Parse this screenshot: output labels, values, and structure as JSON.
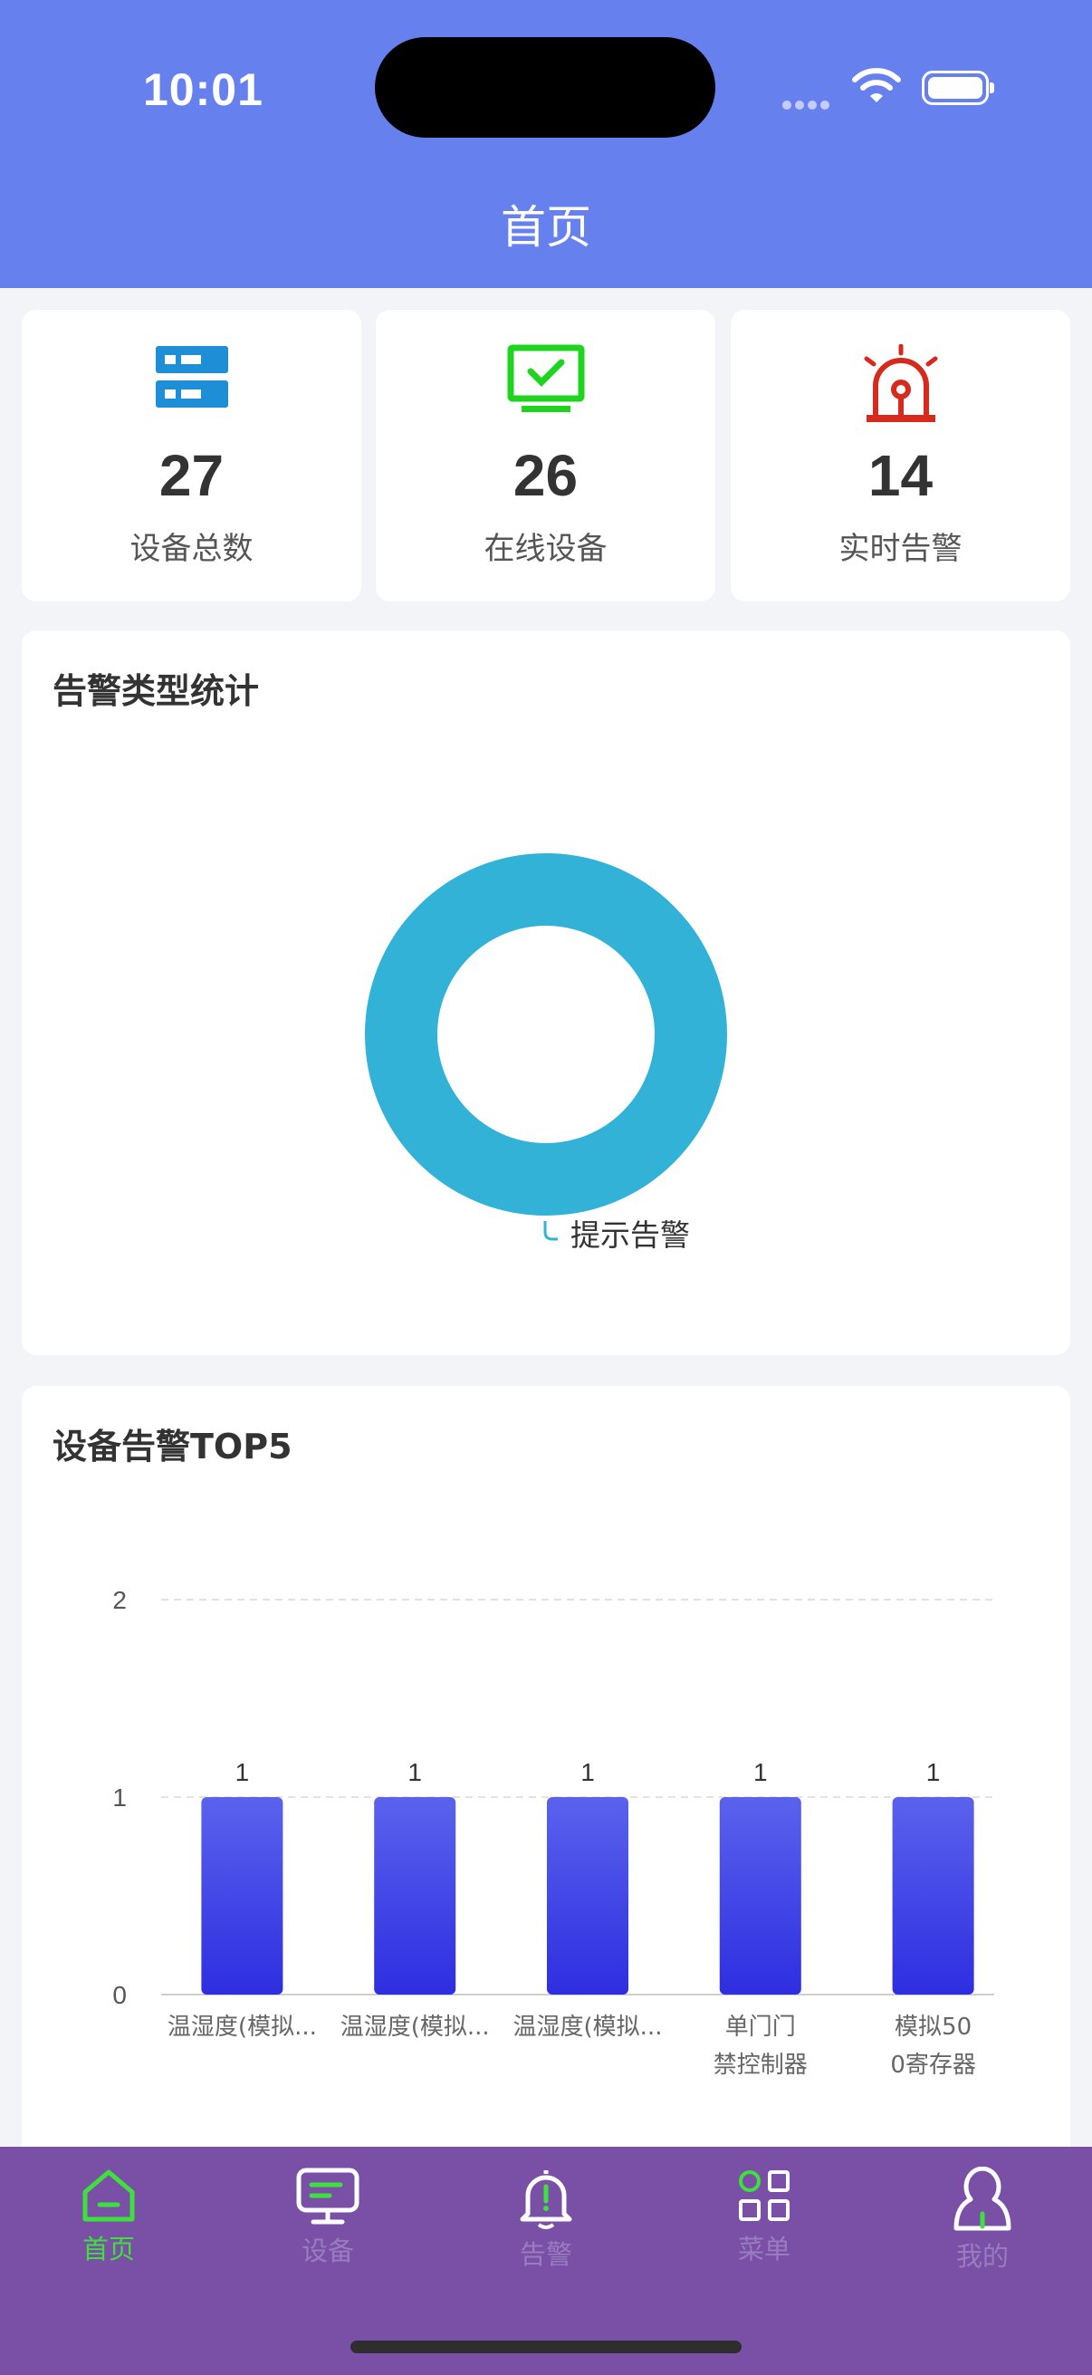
{
  "status_bar": {
    "time": "10:01"
  },
  "header": {
    "title": "首页"
  },
  "stats": [
    {
      "value": "27",
      "label": "设备总数",
      "icon": "server-icon",
      "color": "#1e8fd6"
    },
    {
      "value": "26",
      "label": "在线设备",
      "icon": "monitor-check-icon",
      "color": "#1ed41e"
    },
    {
      "value": "14",
      "label": "实时告警",
      "icon": "alarm-light-icon",
      "color": "#d52a1d"
    }
  ],
  "alarm_type_section": {
    "title": "告警类型统计",
    "chart_data": {
      "type": "pie",
      "slices": [
        {
          "label": "提示告警",
          "value": 1,
          "color": "#32b2d7"
        }
      ]
    }
  },
  "device_alarm_section": {
    "title": "设备告警TOP5",
    "chart_data": {
      "type": "bar",
      "categories": [
        "温湿度(模拟...",
        "温湿度(模拟...",
        "温湿度(模拟...",
        "单门门\n禁控制器",
        "模拟50\n0寄存器"
      ],
      "values": [
        1,
        1,
        1,
        1,
        1
      ],
      "yticks": [
        "0",
        "1",
        "2"
      ],
      "ylim": [
        0,
        2
      ],
      "bar_color_top": "#5a62ec",
      "bar_color_bottom": "#2e2ee0"
    }
  },
  "tabbar": {
    "active_color": "#3ee03e",
    "inactive_color": "#9a7cc1",
    "items": [
      {
        "label": "首页",
        "icon": "home-icon"
      },
      {
        "label": "设备",
        "icon": "device-icon"
      },
      {
        "label": "告警",
        "icon": "bell-alert-icon"
      },
      {
        "label": "菜单",
        "icon": "grid-menu-icon"
      },
      {
        "label": "我的",
        "icon": "user-icon"
      }
    ]
  }
}
